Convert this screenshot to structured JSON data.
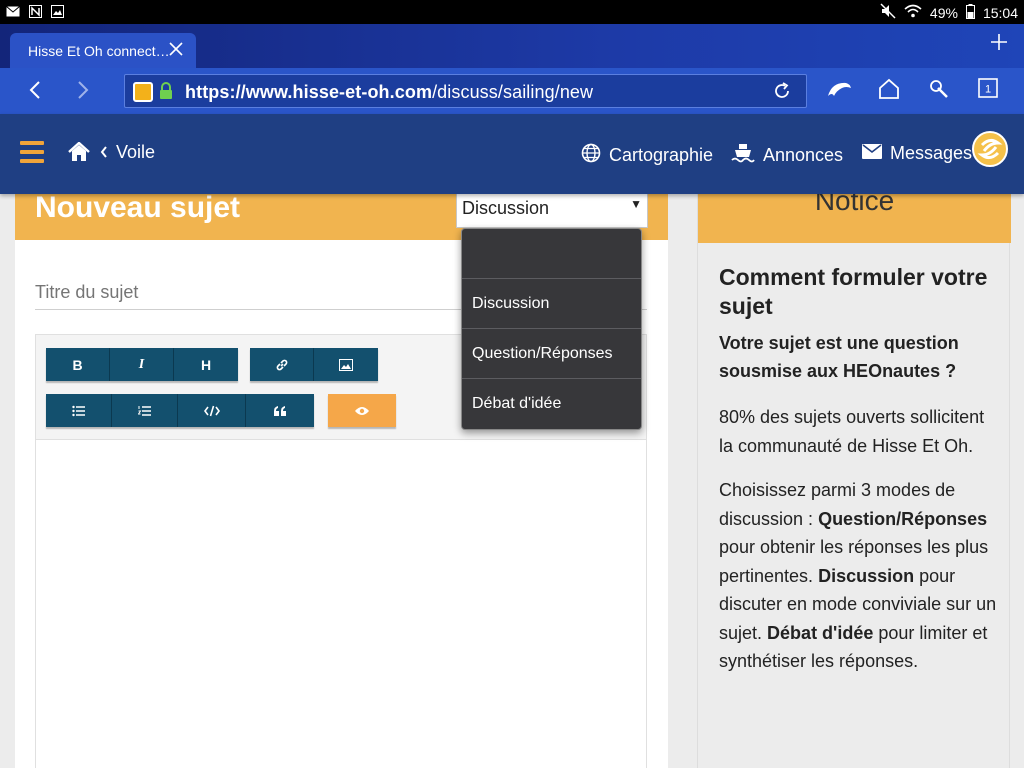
{
  "status_bar": {
    "battery": "49%",
    "time": "15:04"
  },
  "browser": {
    "tab_title": "Hisse Et Oh connect…",
    "url_scheme": "https://",
    "url_domain": "www.hisse-et-oh.com",
    "url_path": "/discuss/sailing/new",
    "tab_count": "1"
  },
  "site_nav": {
    "breadcrumb": "Voile",
    "links": {
      "map": "Cartographie",
      "ads": "Annonces",
      "messages": "Messages"
    }
  },
  "form": {
    "heading": "Nouveau sujet",
    "type_selected": "Discussion",
    "title_placeholder": "Titre du sujet",
    "toolbar_row1": [
      "B",
      "I",
      "H"
    ],
    "dropdown_options": [
      "",
      "Discussion",
      "Question/Réponses",
      "Débat d'idée"
    ]
  },
  "notice": {
    "header": "Notice",
    "heading": "Comment formuler votre sujet",
    "question": "Votre sujet est une question sousmise aux HEOnautes ?",
    "para1": "80% des sujets ouverts sollicitent la communauté de Hisse Et Oh.",
    "para2_intro": "Choisissez parmi 3 modes de discussion :",
    "mode1": "Question/Réponses",
    "mode1_desc": "pour obtenir les réponses les plus pertinentes.",
    "mode2": "Discussion",
    "mode2_desc": "pour discuter en mode conviviale sur un sujet.",
    "mode3": "Débat d'idée",
    "mode3_desc": "pour limiter et synthétiser les réponses."
  },
  "colors": {
    "brand_orange": "#f1b44f",
    "nav_blue": "#1f3f83",
    "toolbar_blue": "#13506e",
    "preview_orange": "#f5a749"
  }
}
